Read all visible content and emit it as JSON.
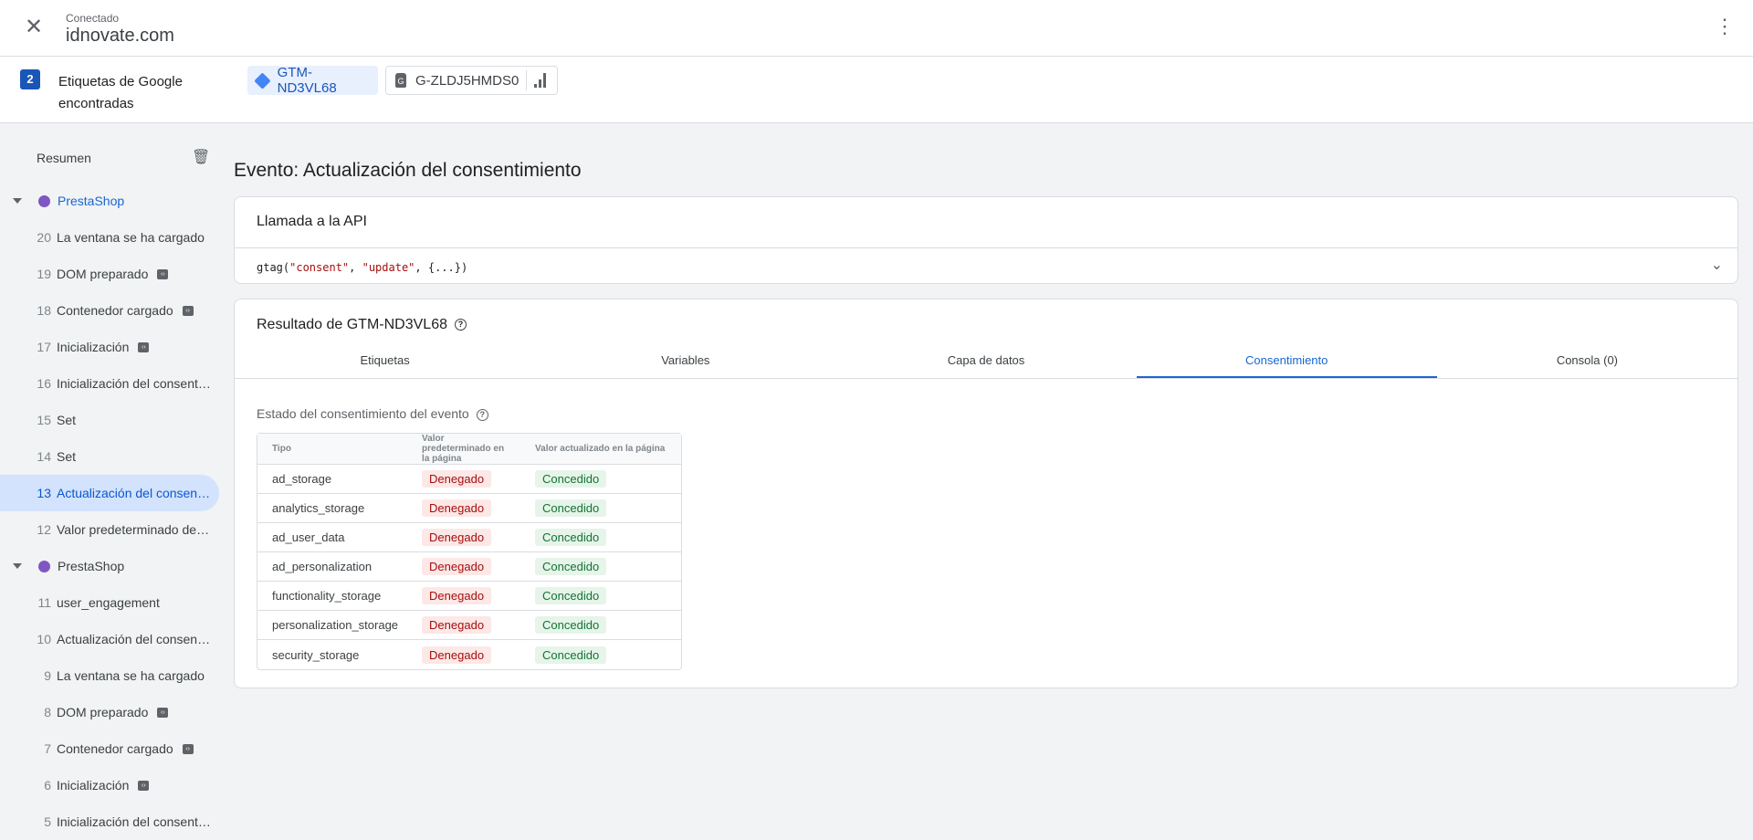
{
  "header": {
    "status": "Conectado",
    "site": "idnovate.com"
  },
  "tags_bar": {
    "count": "2",
    "label": "Etiquetas de Google encontradas",
    "chips": [
      {
        "id": "GTM-ND3VL68"
      },
      {
        "id": "G-ZLDJ5HMDS0"
      }
    ]
  },
  "sidebar": {
    "summary": "Resumen",
    "groups": [
      {
        "name": "PrestaShop",
        "items": [
          {
            "n": "20",
            "label": "La ventana se ha cargado"
          },
          {
            "n": "19",
            "label": "DOM preparado"
          },
          {
            "n": "18",
            "label": "Contenedor cargado"
          },
          {
            "n": "17",
            "label": "Inicialización"
          },
          {
            "n": "16",
            "label": "Inicialización del consentimiento"
          },
          {
            "n": "15",
            "label": "Set"
          },
          {
            "n": "14",
            "label": "Set"
          },
          {
            "n": "13",
            "label": "Actualización del consentimiento"
          },
          {
            "n": "12",
            "label": "Valor predeterminado del consentimiento"
          }
        ]
      },
      {
        "name": "PrestaShop",
        "items": [
          {
            "n": "11",
            "label": "user_engagement"
          },
          {
            "n": "10",
            "label": "Actualización del consentimiento"
          },
          {
            "n": "9",
            "label": "La ventana se ha cargado"
          },
          {
            "n": "8",
            "label": "DOM preparado"
          },
          {
            "n": "7",
            "label": "Contenedor cargado"
          },
          {
            "n": "6",
            "label": "Inicialización"
          },
          {
            "n": "5",
            "label": "Inicialización del consentimiento"
          }
        ]
      }
    ]
  },
  "main": {
    "title": "Evento: Actualización del consentimiento",
    "api": {
      "heading": "Llamada a la API",
      "code_fn": "gtag(",
      "code_a": "\"consent\"",
      "code_sep": ", ",
      "code_b": "\"update\"",
      "code_end": ", {...})"
    },
    "result": {
      "heading": "Resultado de GTM-ND3VL68",
      "tabs": [
        "Etiquetas",
        "Variables",
        "Capa de datos",
        "Consentimiento",
        "Consola (0)"
      ],
      "active_tab": "Consentimiento",
      "section": "Estado del consentimiento del evento",
      "columns": [
        "Tipo",
        "Valor predeterminado en la página",
        "Valor actualizado en la página"
      ],
      "rows": [
        [
          "ad_storage",
          "Denegado",
          "Concedido"
        ],
        [
          "analytics_storage",
          "Denegado",
          "Concedido"
        ],
        [
          "ad_user_data",
          "Denegado",
          "Concedido"
        ],
        [
          "ad_personalization",
          "Denegado",
          "Concedido"
        ],
        [
          "functionality_storage",
          "Denegado",
          "Concedido"
        ],
        [
          "personalization_storage",
          "Denegado",
          "Concedido"
        ],
        [
          "security_storage",
          "Denegado",
          "Concedido"
        ]
      ]
    }
  }
}
